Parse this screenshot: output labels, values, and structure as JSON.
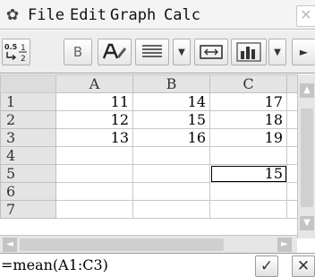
{
  "menubar": {
    "items": [
      "File",
      "Edit",
      "Graph",
      "Calc"
    ]
  },
  "toolbar": {
    "fraction_top": "0.5",
    "fraction_bottom": "1",
    "fraction_right": "2",
    "bold_label": "B"
  },
  "spreadsheet": {
    "columns": [
      "A",
      "B",
      "C"
    ],
    "rows": [
      {
        "label": "1",
        "cells": [
          "11",
          "14",
          "17"
        ]
      },
      {
        "label": "2",
        "cells": [
          "12",
          "15",
          "18"
        ]
      },
      {
        "label": "3",
        "cells": [
          "13",
          "16",
          "19"
        ]
      },
      {
        "label": "4",
        "cells": [
          "",
          "",
          ""
        ]
      },
      {
        "label": "5",
        "cells": [
          "",
          "",
          "15"
        ]
      },
      {
        "label": "6",
        "cells": [
          "",
          "",
          ""
        ]
      },
      {
        "label": "7",
        "cells": [
          "",
          "",
          ""
        ]
      }
    ],
    "selected_cell": "C5"
  },
  "editline": {
    "formula": "=mean(A1:C3)"
  }
}
